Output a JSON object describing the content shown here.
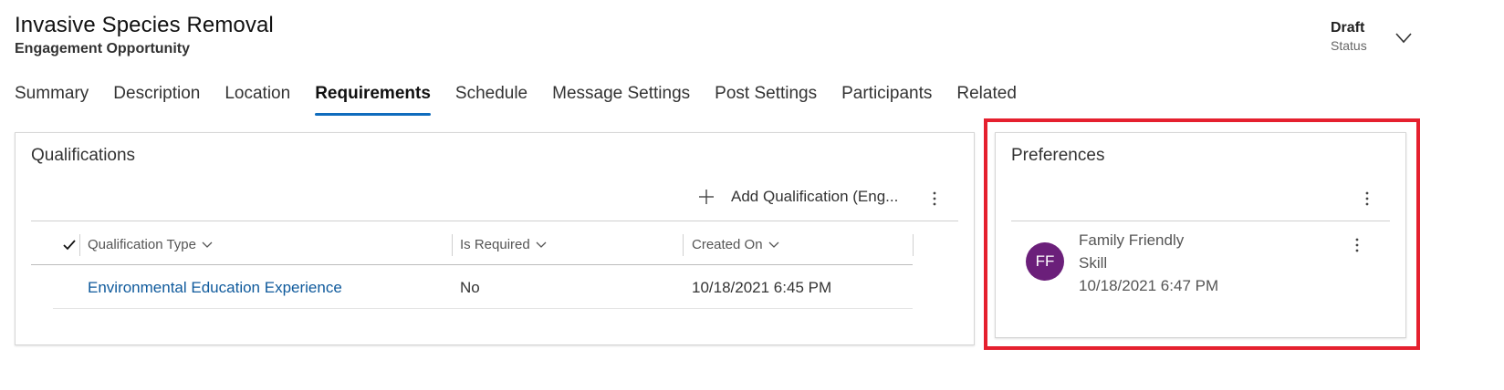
{
  "header": {
    "title": "Invasive Species Removal",
    "subtitle": "Engagement Opportunity",
    "status_value": "Draft",
    "status_label": "Status",
    "status_chevron_icon": "chevron-down-icon"
  },
  "tabs": [
    {
      "label": "Summary",
      "active": false
    },
    {
      "label": "Description",
      "active": false
    },
    {
      "label": "Location",
      "active": false
    },
    {
      "label": "Requirements",
      "active": true
    },
    {
      "label": "Schedule",
      "active": false
    },
    {
      "label": "Message Settings",
      "active": false
    },
    {
      "label": "Post Settings",
      "active": false
    },
    {
      "label": "Participants",
      "active": false
    },
    {
      "label": "Related",
      "active": false
    }
  ],
  "qualifications": {
    "title": "Qualifications",
    "add_label": "Add Qualification (Eng...",
    "columns": [
      {
        "label": "Qualification Type"
      },
      {
        "label": "Is Required"
      },
      {
        "label": "Created On"
      }
    ],
    "rows": [
      {
        "type": "Environmental Education Experience",
        "required": "No",
        "created_on": "10/18/2021 6:45 PM"
      }
    ]
  },
  "preferences": {
    "title": "Preferences",
    "items": [
      {
        "initials": "FF",
        "name": "Family Friendly",
        "kind": "Skill",
        "date": "10/18/2021 6:47 PM",
        "avatar_color": "#6b1f7a"
      }
    ]
  },
  "colors": {
    "accent": "#0f6cbd",
    "link": "#0f5a9c",
    "highlight": "#e5202e"
  }
}
